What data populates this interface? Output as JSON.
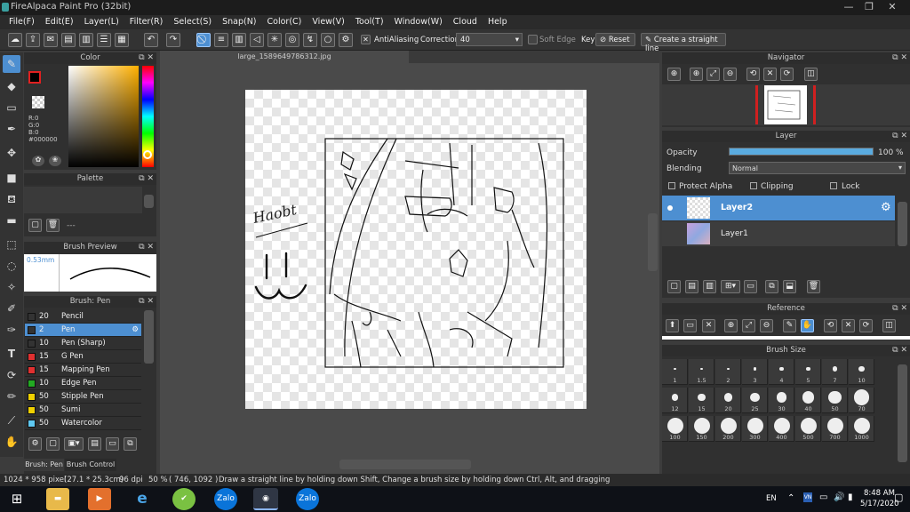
{
  "app": {
    "title": "FireAlpaca Paint Pro (32bit)"
  },
  "menu": [
    "File(F)",
    "Edit(E)",
    "Layer(L)",
    "Filter(R)",
    "Select(S)",
    "Snap(N)",
    "Color(C)",
    "View(V)",
    "Tool(T)",
    "Window(W)",
    "Cloud",
    "Help"
  ],
  "toolbar": {
    "antialiasing_label": "AntiAliasing",
    "correction_label": "Correction",
    "correction_value": "40",
    "soft_edge_label": "Soft Edge",
    "key_label": "Key",
    "reset_label": "Reset",
    "straight_line_label": "Create a straight line"
  },
  "color_panel": {
    "title": "Color",
    "r": "R:0",
    "g": "G:0",
    "b": "B:0",
    "hex": "#000000",
    "primary": "#000000",
    "secondary": "#ffffff"
  },
  "palette_panel": {
    "title": "Palette",
    "empty": "---"
  },
  "brush_preview": {
    "title": "Brush Preview",
    "size": "0.53mm"
  },
  "brush_panel": {
    "title": "Brush: Pen",
    "items": [
      {
        "size": "20",
        "name": "Pencil",
        "color": "#333333"
      },
      {
        "size": "2",
        "name": "Pen",
        "color": "#333333",
        "selected": true
      },
      {
        "size": "10",
        "name": "Pen (Sharp)",
        "color": "#333333"
      },
      {
        "size": "15",
        "name": "G Pen",
        "color": "#e03030"
      },
      {
        "size": "15",
        "name": "Mapping Pen",
        "color": "#e03030"
      },
      {
        "size": "10",
        "name": "Edge Pen",
        "color": "#22aa22"
      },
      {
        "size": "50",
        "name": "Stipple Pen",
        "color": "#f0d000"
      },
      {
        "size": "50",
        "name": "Sumi",
        "color": "#f0d000"
      },
      {
        "size": "50",
        "name": "Watercolor",
        "color": "#5fc8f0"
      }
    ],
    "tab_pen": "Brush: Pen",
    "tab_control": "Brush Control"
  },
  "document": {
    "tab_title": "large_1589649786312.jpg"
  },
  "navigator": {
    "title": "Navigator"
  },
  "layer_panel": {
    "title": "Layer",
    "opacity_label": "Opacity",
    "opacity_value": "100 %",
    "opacity_fraction": 1.0,
    "blending_label": "Blending",
    "blending_value": "Normal",
    "protect_alpha": "Protect Alpha",
    "clipping": "Clipping",
    "lock": "Lock",
    "layers": [
      {
        "name": "Layer2",
        "selected": true
      },
      {
        "name": "Layer1",
        "selected": false
      }
    ]
  },
  "reference": {
    "title": "Reference"
  },
  "brush_size": {
    "title": "Brush Size",
    "sizes": [
      "1",
      "1.5",
      "2",
      "3",
      "4",
      "5",
      "7",
      "10",
      "12",
      "15",
      "20",
      "25",
      "30",
      "40",
      "50",
      "70",
      "100",
      "150",
      "200",
      "300",
      "400",
      "500",
      "700",
      "1000"
    ]
  },
  "status": {
    "dimensions": "1024 * 958 pixel",
    "physical": "(27.1 * 25.3cm)",
    "dpi": "96 dpi",
    "zoom": "50 %",
    "coords": "( 746, 1092 )",
    "hint": "Draw a straight line by holding down Shift, Change a brush size by holding down Ctrl, Alt, and dragging"
  },
  "taskbar": {
    "lang": "EN",
    "time": "8:48 AM",
    "date": "5/17/2020",
    "zalo1": "Zalo",
    "zalo2": "Zalo"
  },
  "artwork": {
    "signature": "Haobt"
  }
}
